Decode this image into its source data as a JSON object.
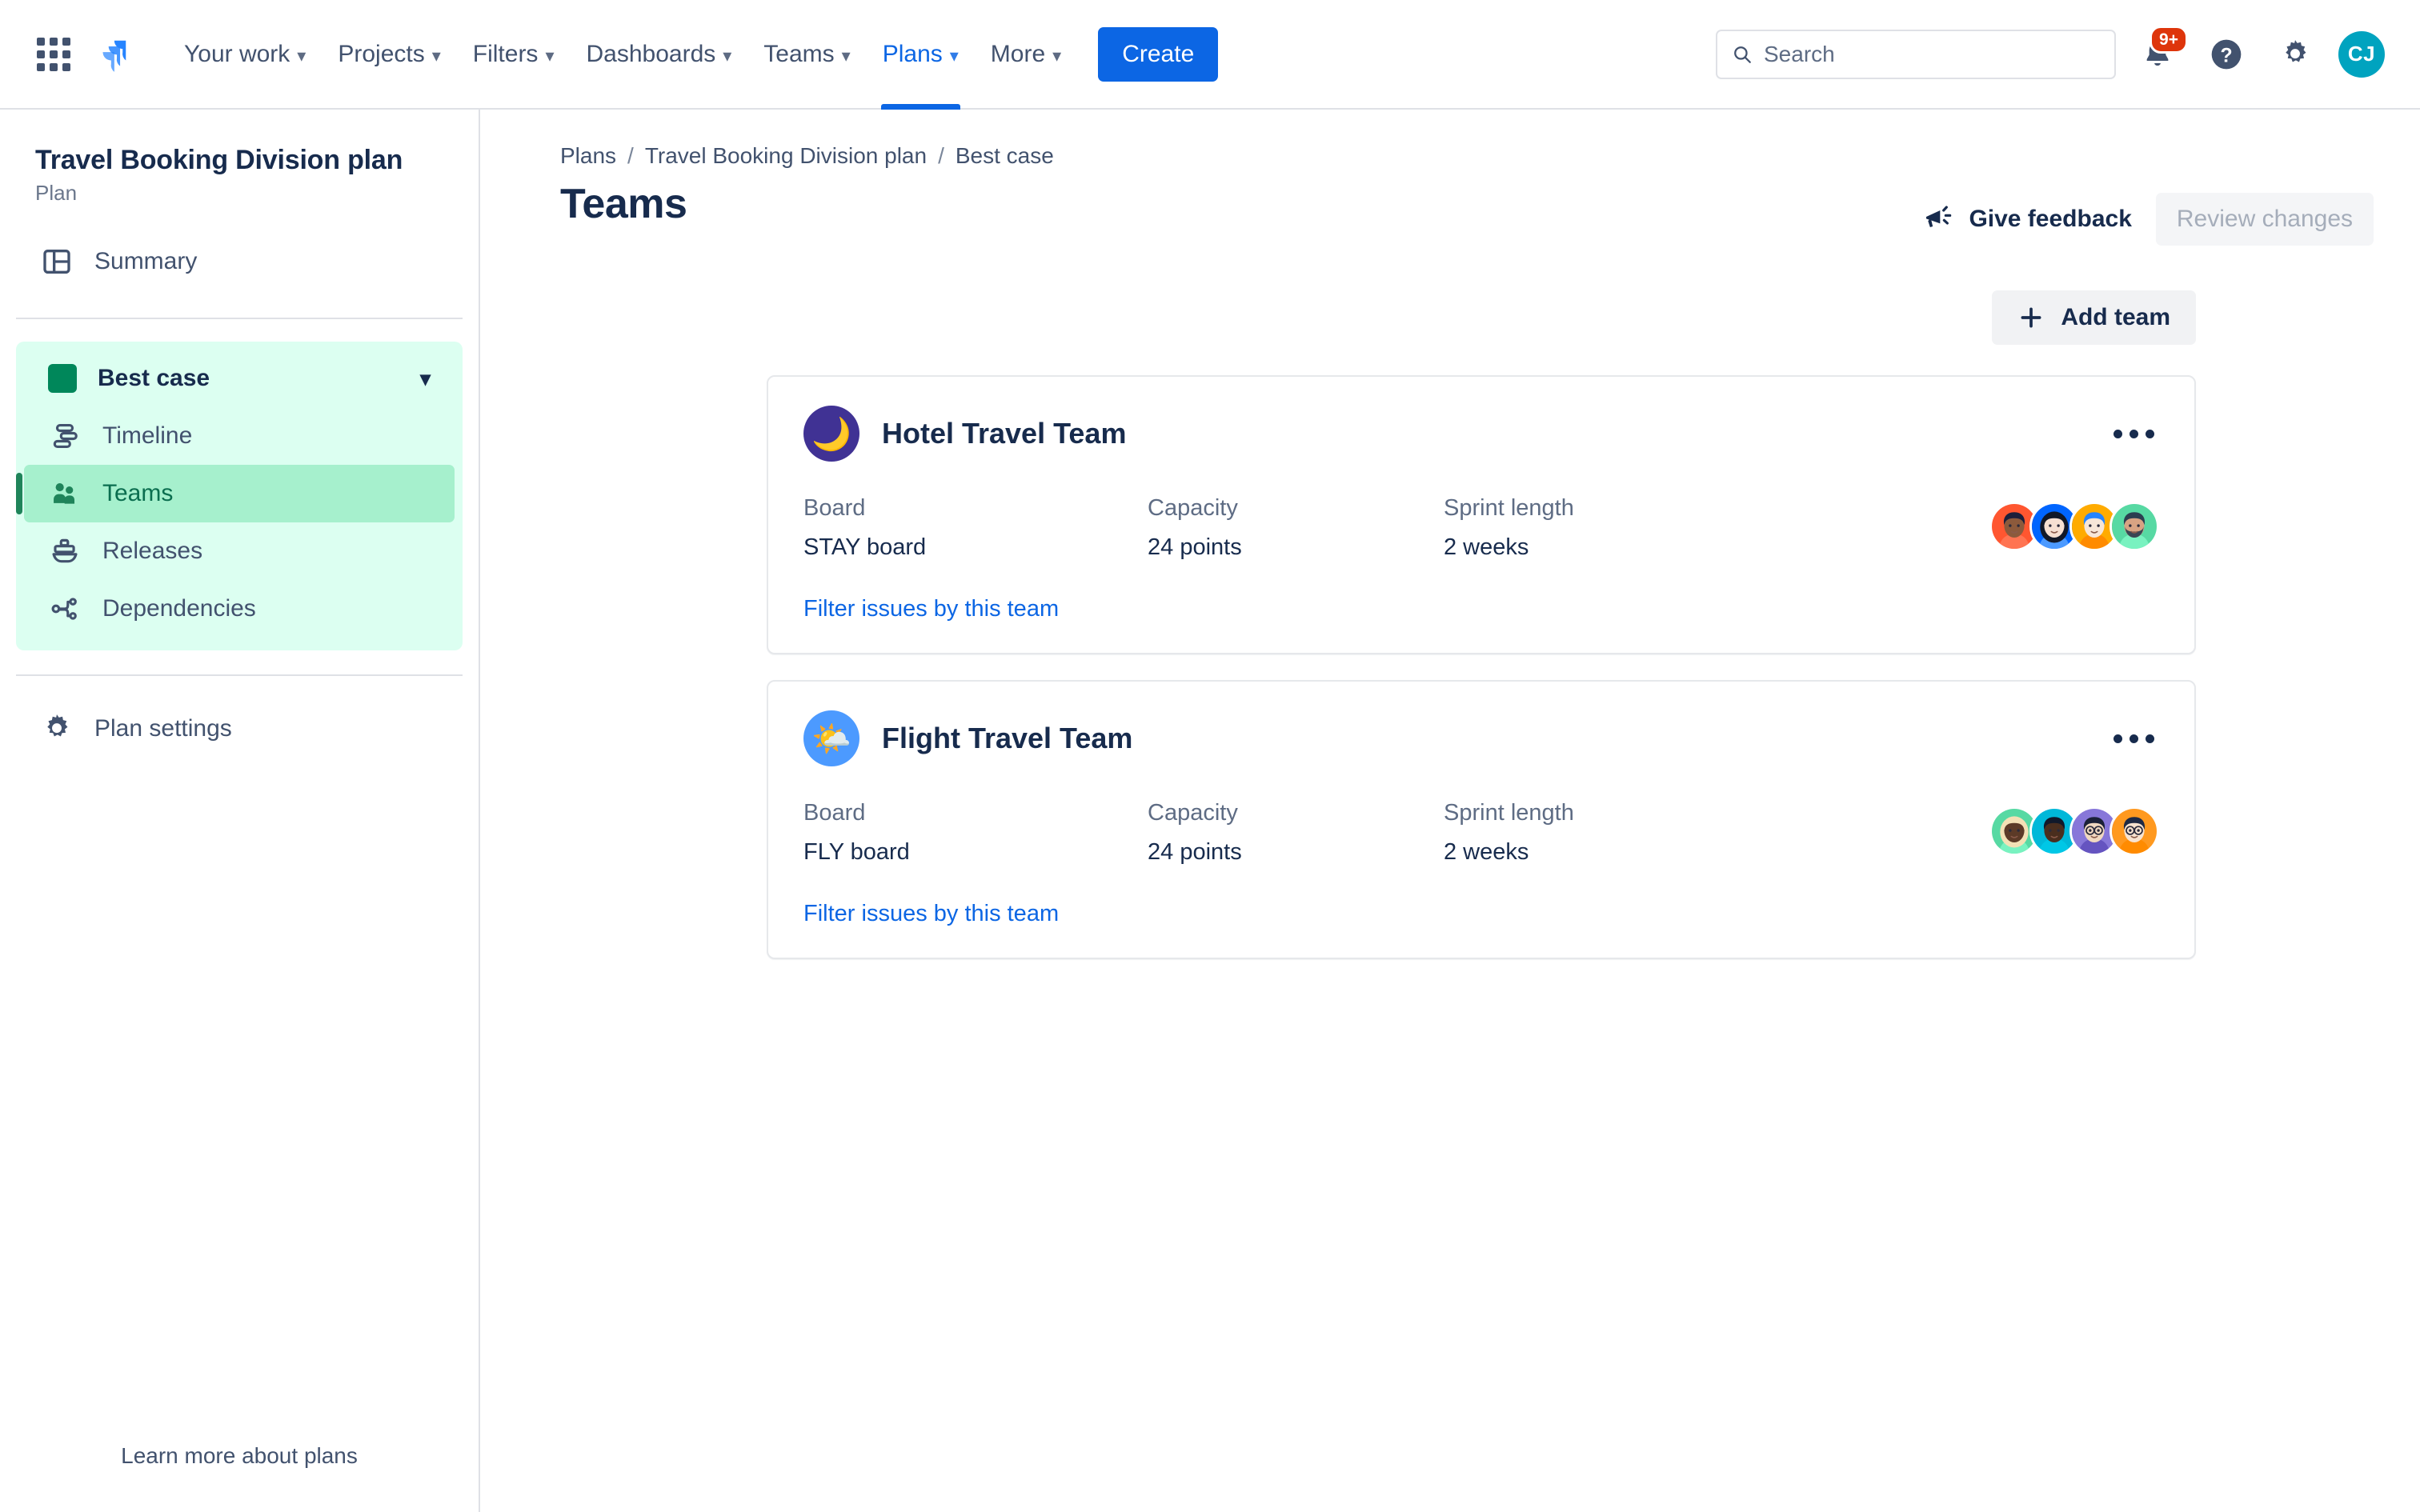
{
  "topnav": {
    "app_switcher_icon": "grid-icon",
    "logo": "jira-logo",
    "items": [
      {
        "label": "Your work",
        "has_chevron": true,
        "active": false
      },
      {
        "label": "Projects",
        "has_chevron": true,
        "active": false
      },
      {
        "label": "Filters",
        "has_chevron": true,
        "active": false
      },
      {
        "label": "Dashboards",
        "has_chevron": true,
        "active": false
      },
      {
        "label": "Teams",
        "has_chevron": true,
        "active": false
      },
      {
        "label": "Plans",
        "has_chevron": true,
        "active": true
      },
      {
        "label": "More",
        "has_chevron": true,
        "active": false
      }
    ],
    "create_label": "Create",
    "search": {
      "placeholder": "Search",
      "value": "",
      "icon": "search-icon"
    },
    "notifications": {
      "icon": "bell-icon",
      "badge": "9+"
    },
    "help": {
      "icon": "help-icon"
    },
    "settings": {
      "icon": "gear-icon"
    },
    "profile": {
      "initials": "CJ",
      "color": "#00a3bf"
    }
  },
  "sidebar": {
    "plan_name": "Travel Booking Division plan",
    "plan_type": "Plan",
    "summary": {
      "label": "Summary",
      "icon": "summary-icon"
    },
    "scenario": {
      "label": "Best case",
      "swatch_color": "#00875a",
      "chevron": "chevron-down-icon",
      "items": [
        {
          "label": "Timeline",
          "icon": "timeline-icon",
          "selected": false
        },
        {
          "label": "Teams",
          "icon": "teams-icon",
          "selected": true
        },
        {
          "label": "Releases",
          "icon": "releases-icon",
          "selected": false
        },
        {
          "label": "Dependencies",
          "icon": "dependencies-icon",
          "selected": false
        }
      ]
    },
    "plan_settings": {
      "label": "Plan settings",
      "icon": "gear-icon"
    },
    "learn_more": "Learn more about plans"
  },
  "main": {
    "breadcrumb": [
      "Plans",
      "Travel Booking Division plan",
      "Best case"
    ],
    "breadcrumb_separator": "/",
    "page_title": "Teams",
    "give_feedback_label": "Give feedback",
    "give_feedback_icon": "megaphone-icon",
    "review_changes_label": "Review changes",
    "review_changes_disabled": true,
    "add_team_label": "Add team",
    "add_team_icon": "plus-icon",
    "column_labels": {
      "board": "Board",
      "capacity": "Capacity",
      "sprint_length": "Sprint length"
    },
    "filter_link_label": "Filter issues by this team",
    "more_menu_icon": "more-horizontal-icon",
    "teams": [
      {
        "name": "Hotel Travel Team",
        "avatar_emoji": "🌙",
        "avatar_bg": "#403294",
        "board": "STAY board",
        "capacity": "24 points",
        "sprint_length": "2 weeks",
        "members": [
          {
            "bg": "#ff5630",
            "skin": "#8c5a3c",
            "hair": "#1b1f3b",
            "shirt": "#ff7452",
            "beard": false,
            "glasses": false,
            "long_hair": false
          },
          {
            "bg": "#0065ff",
            "skin": "#f6e0d2",
            "hair": "#111827",
            "shirt": "#4c9aff",
            "beard": false,
            "glasses": false,
            "long_hair": true
          },
          {
            "bg": "#ffab00",
            "skin": "#f7e6d8",
            "hair": "#2684ff",
            "shirt": "#ff8b00",
            "beard": false,
            "glasses": false,
            "long_hair": false
          },
          {
            "bg": "#57d9a3",
            "skin": "#d8a383",
            "hair": "#2c3e50",
            "shirt": "#79f2c0",
            "beard": true,
            "glasses": false,
            "long_hair": false
          }
        ]
      },
      {
        "name": "Flight Travel Team",
        "avatar_emoji": "🌤️",
        "avatar_bg": "#4c9aff",
        "board": "FLY board",
        "capacity": "24 points",
        "sprint_length": "2 weeks",
        "members": [
          {
            "bg": "#57d9a3",
            "skin": "#5c3a27",
            "hair": "#f3e0b5",
            "shirt": "#79f2c0",
            "beard": false,
            "glasses": false,
            "long_hair": true
          },
          {
            "bg": "#00b8d9",
            "skin": "#4a2e1e",
            "hair": "#10192b",
            "shirt": "#00c7e6",
            "beard": false,
            "glasses": false,
            "long_hair": false
          },
          {
            "bg": "#8777d9",
            "skin": "#f0d8c0",
            "hair": "#1b2138",
            "shirt": "#6554c0",
            "beard": false,
            "glasses": true,
            "long_hair": false
          },
          {
            "bg": "#ff991f",
            "skin": "#f7e3d0",
            "hair": "#1f2a44",
            "shirt": "#ff8b00",
            "beard": false,
            "glasses": true,
            "long_hair": false
          }
        ]
      }
    ]
  }
}
